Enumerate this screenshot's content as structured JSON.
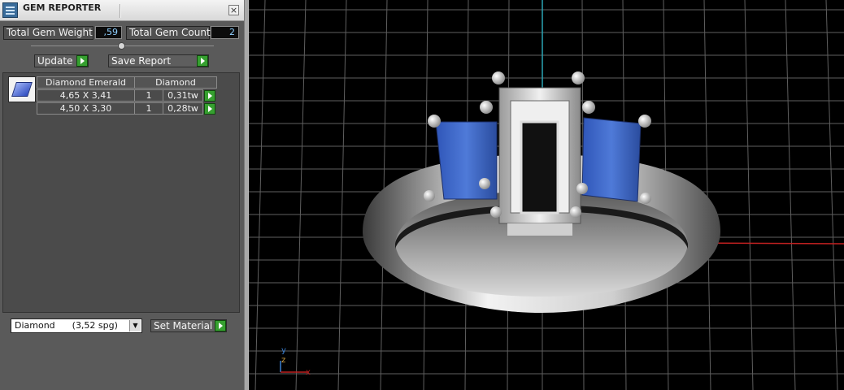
{
  "panel": {
    "title": "GEM REPORTER",
    "close_label": "×",
    "total_weight_label": "Total Gem Weight",
    "total_weight_value": ",59",
    "total_count_label": "Total Gem Count",
    "total_count_value": "2",
    "update_label": "Update",
    "save_report_label": "Save Report",
    "table": {
      "headers": [
        "Diamond Emerald",
        "Diamond"
      ],
      "rows": [
        {
          "size": "4,65 X 3,41",
          "count": "1",
          "weight": "0,31tw"
        },
        {
          "size": "4,50 X 3,30",
          "count": "1",
          "weight": "0,28tw"
        }
      ]
    },
    "material_select_value": "Diamond      (3,52 spg)",
    "set_material_label": "Set Material"
  },
  "viewport": {
    "axis_y_label": "y",
    "axis_z_label": "z",
    "axis_x_label": "x",
    "colors": {
      "grid": "#6a6a6a",
      "x_axis": "#c02020",
      "y_axis": "#2aa4b4",
      "gem_blue": "#3b63c6",
      "metal": "#d8d8d8"
    }
  }
}
